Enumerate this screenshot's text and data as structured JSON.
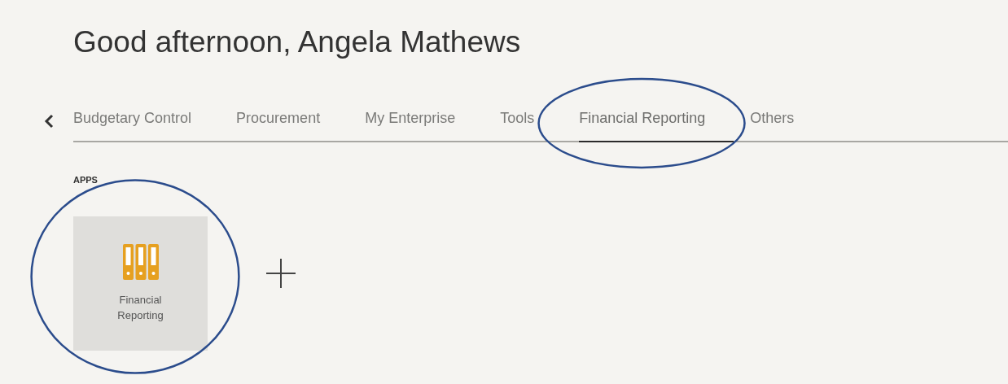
{
  "greeting": "Good afternoon, Angela Mathews",
  "tabs": [
    {
      "label": "Budgetary Control",
      "selected": false,
      "circled": false
    },
    {
      "label": "Procurement",
      "selected": false,
      "circled": false
    },
    {
      "label": "My Enterprise",
      "selected": false,
      "circled": false
    },
    {
      "label": "Tools",
      "selected": false,
      "circled": false
    },
    {
      "label": "Financial Reporting",
      "selected": true,
      "circled": true
    },
    {
      "label": "Others",
      "selected": false,
      "circled": false
    }
  ],
  "apps_heading": "APPS",
  "apps": [
    {
      "label": "Financial Reporting",
      "circled": true
    }
  ]
}
